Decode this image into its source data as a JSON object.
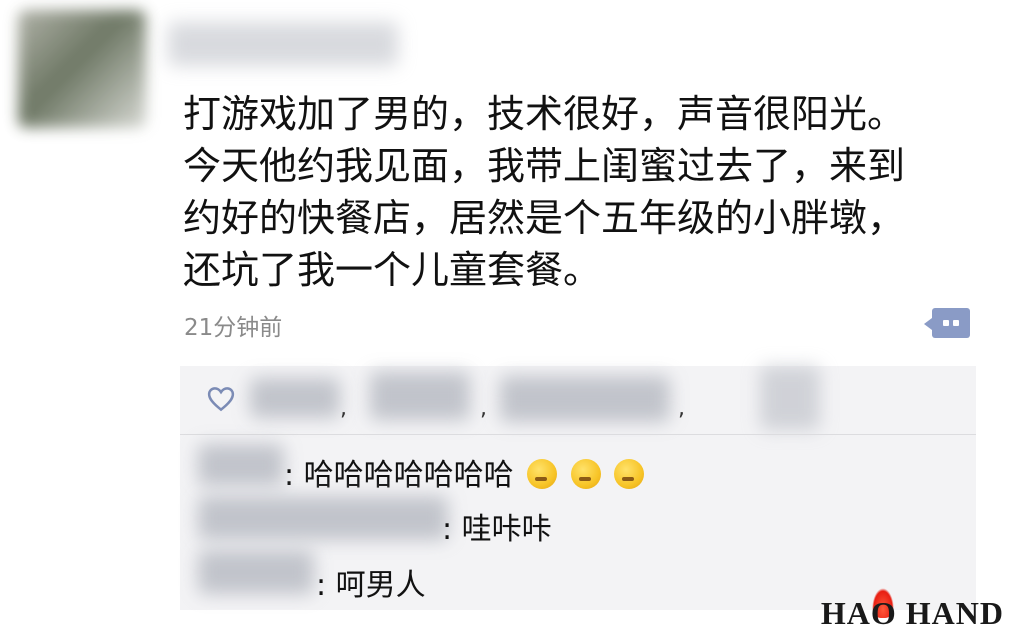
{
  "post": {
    "lines": [
      "打游戏加了男的，技术很好，声音很阳光。",
      "今天他约我见面，我带上闺蜜过去了，来到",
      "约好的快餐店，居然是个五年级的小胖墩，",
      "还坑了我一个儿童套餐。"
    ],
    "time": "21分钟前"
  },
  "actions": {
    "comment_icon": "comment-bubble-icon"
  },
  "likes": {
    "icon": "heart-icon",
    "separators": [
      ",",
      ",",
      ","
    ]
  },
  "comments": [
    {
      "sep": ":",
      "text": "哈哈哈哈哈哈哈",
      "emojis": [
        "thinking-face-emoji",
        "thinking-face-emoji",
        "thinking-face-emoji"
      ]
    },
    {
      "sep": ":",
      "text": "哇咔咔"
    },
    {
      "sep": ":",
      "text": "呵男人"
    }
  ],
  "watermark": {
    "text": "HAO HAND"
  }
}
